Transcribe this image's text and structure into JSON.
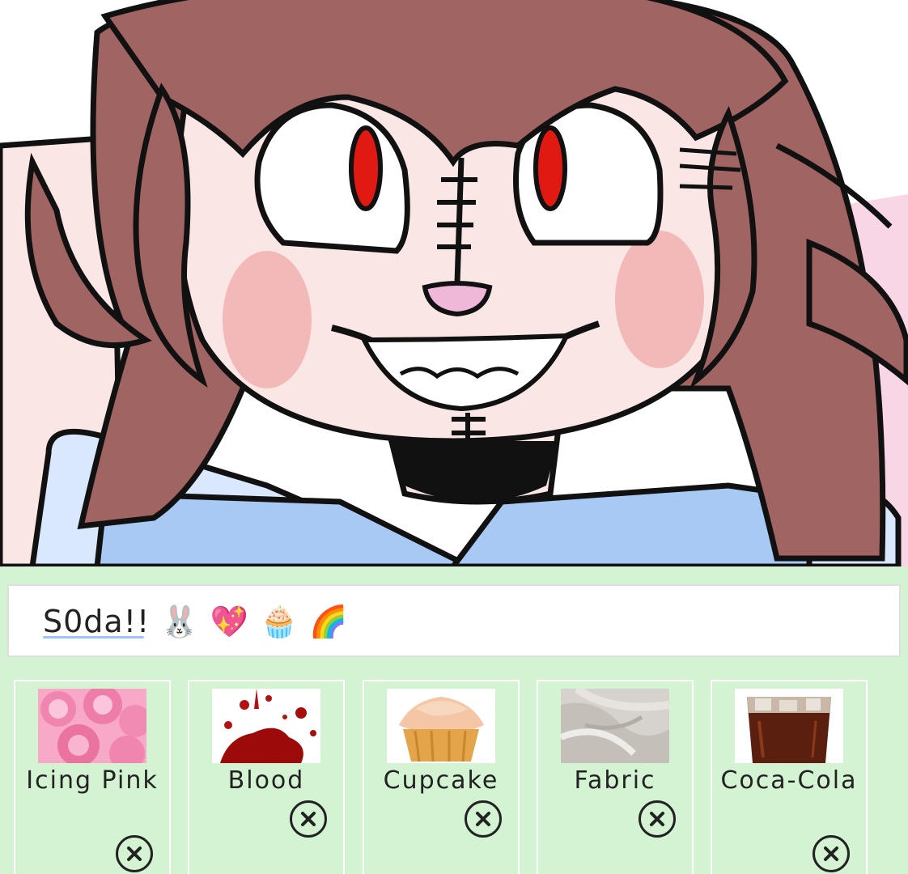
{
  "input": {
    "text": "S0da!! 🐰 💖 🧁 🌈"
  },
  "chips": [
    {
      "label": "Icing Pink",
      "thumbnail": "pink-icing-image",
      "remove_icon": "close-circle-icon"
    },
    {
      "label": "Blood",
      "thumbnail": "blood-splatter-image",
      "remove_icon": "close-circle-icon"
    },
    {
      "label": "Cupcake",
      "thumbnail": "cupcake-image",
      "remove_icon": "close-circle-icon"
    },
    {
      "label": "Fabric",
      "thumbnail": "fabric-image",
      "remove_icon": "close-circle-icon"
    },
    {
      "label": "Coca-Cola",
      "thumbnail": "cola-glass-image",
      "remove_icon": "close-circle-icon"
    }
  ],
  "colors": {
    "panel_background": "#d3f3d2",
    "hair": "#a06462",
    "skin": "#fbe6e6",
    "blush": "#f3b8b8",
    "eye_red": "#e01a12",
    "shirt": "#a9c9f5"
  }
}
